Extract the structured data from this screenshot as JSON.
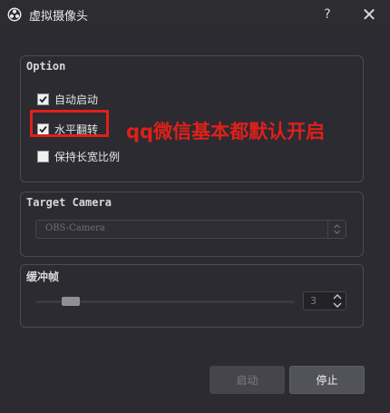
{
  "window": {
    "title": "虚拟摄像头",
    "help_label": "?",
    "close_label": "✕"
  },
  "option_group": {
    "title": "Option",
    "checkboxes": [
      {
        "label": "自动启动",
        "checked": true
      },
      {
        "label": "水平翻转",
        "checked": true
      },
      {
        "label": "保持长宽比例",
        "checked": false
      }
    ]
  },
  "annotation": {
    "text": "qq微信基本都默认开启",
    "color": "#e0201a"
  },
  "target_group": {
    "title": "Target Camera",
    "selected_camera": "OBS-Camera"
  },
  "buffer_group": {
    "title": "缓冲帧",
    "value": "3",
    "slider_fraction": 0.1
  },
  "buttons": {
    "start_label": "启动",
    "stop_label": "停止"
  },
  "icons": {
    "app": "obs-logo-icon",
    "help": "help-icon",
    "close": "close-icon",
    "combo": "updown-chevron-icon",
    "spin": "spin-arrows-icon"
  }
}
